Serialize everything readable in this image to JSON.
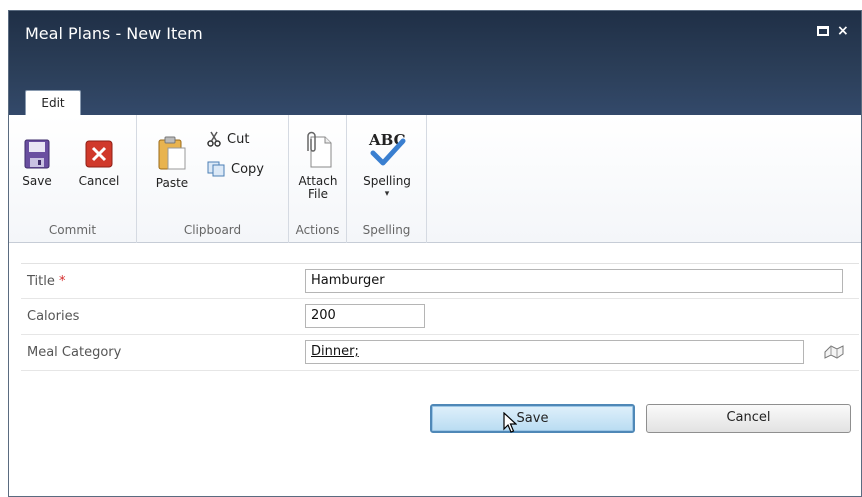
{
  "window": {
    "title": "Meal Plans - New Item",
    "controls": [
      "maximize-icon",
      "close-icon"
    ],
    "close_glyph": "×"
  },
  "ribbon": {
    "tabs": [
      {
        "label": "Edit",
        "selected": true
      }
    ],
    "groups": {
      "commit": {
        "label": "Commit",
        "save": "Save",
        "cancel": "Cancel"
      },
      "clipboard": {
        "label": "Clipboard",
        "paste": "Paste",
        "cut": "Cut",
        "copy": "Copy"
      },
      "actions": {
        "label": "Actions",
        "attach_line1": "Attach",
        "attach_line2": "File"
      },
      "spelling": {
        "label": "Spelling",
        "spelling": "Spelling",
        "abc": "ABC",
        "dropdown_glyph": "▾"
      }
    }
  },
  "form": {
    "fields": [
      {
        "label": "Title",
        "required_mark": "*",
        "value": "Hamburger"
      },
      {
        "label": "Calories",
        "value": "200"
      },
      {
        "label": "Meal Category",
        "value": "Dinner;"
      }
    ]
  },
  "buttons": {
    "save": "Save",
    "cancel": "Cancel"
  },
  "colors": {
    "titlebar": "#2b3e58",
    "required": "#d42a2a",
    "save_button_border": "#4f88b7"
  }
}
